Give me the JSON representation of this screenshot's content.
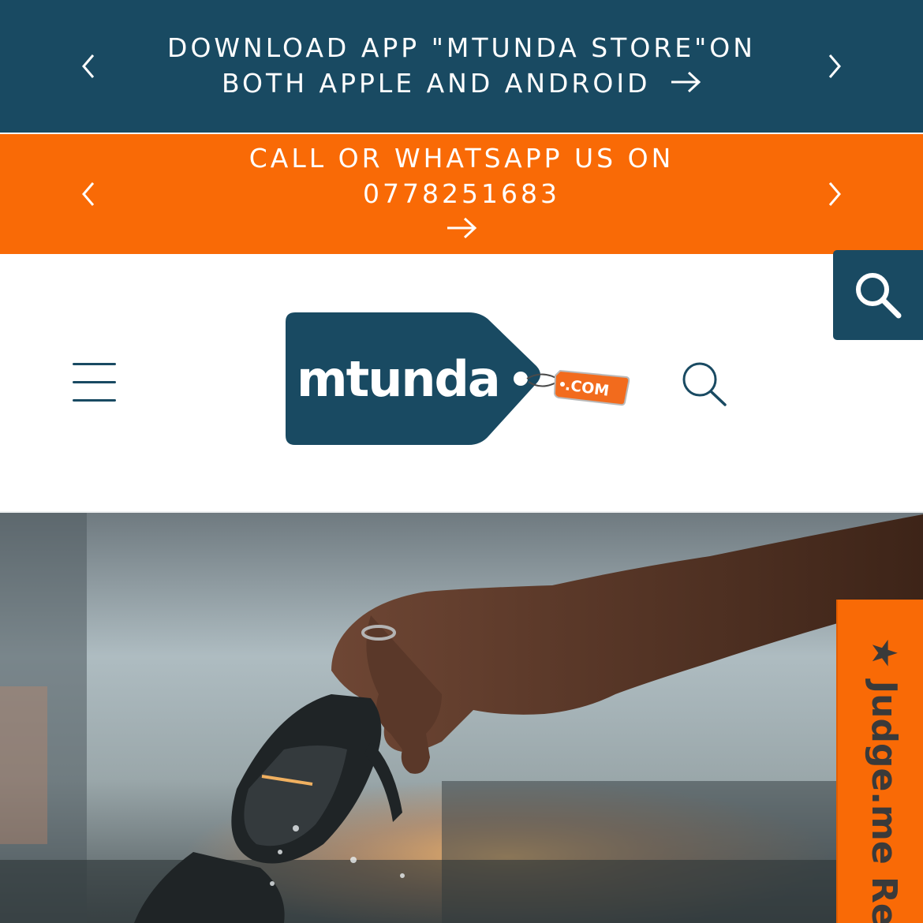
{
  "announcements": [
    {
      "text": "DOWNLOAD APP \"MTUNDA STORE\"ON BOTH APPLE AND ANDROID",
      "color": "#194a62"
    },
    {
      "text": "CALL OR WHATSAPP US ON 0778251683",
      "color": "#f96a06"
    }
  ],
  "icons": {
    "prev": "chevron-left-icon",
    "next": "chevron-right-icon",
    "arrow": "arrow-right-icon",
    "menu": "hamburger-menu-icon",
    "search": "search-icon"
  },
  "logo": {
    "word": "mtunda",
    "tag": ".COM",
    "brand_color": "#194a62",
    "tag_color": "#f26b1d"
  },
  "reviews_tab": {
    "star": "★",
    "label": "Judge.me Re"
  },
  "colors": {
    "navy": "#194a62",
    "orange": "#f96a06"
  }
}
